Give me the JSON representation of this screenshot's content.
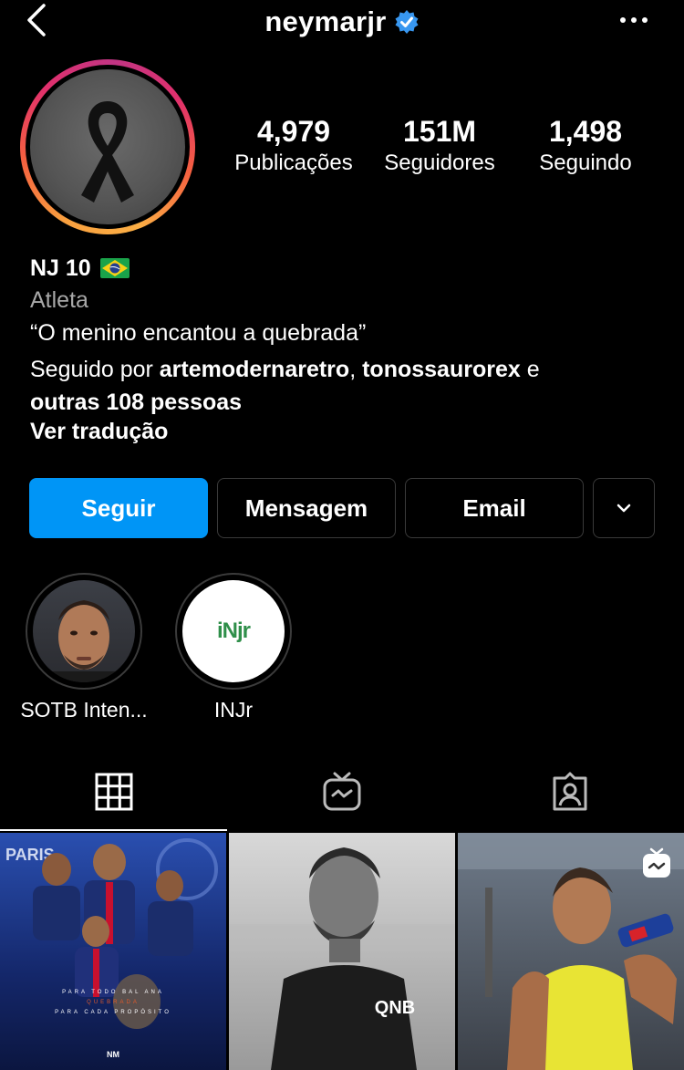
{
  "header": {
    "username": "neymarjr",
    "icons": {
      "back": "chevron-left-icon",
      "verified": "verified-badge-icon",
      "more": "more-horizontal-icon"
    },
    "verified_color": "#3897f0"
  },
  "avatar": {
    "icon": "black-ribbon-icon"
  },
  "stats": [
    {
      "value": "4,979",
      "label": "Publicações"
    },
    {
      "value": "151M",
      "label": "Seguidores"
    },
    {
      "value": "1,498",
      "label": "Seguindo"
    }
  ],
  "profile": {
    "name": "NJ 10",
    "flag_icon": "brazil-flag-icon",
    "category": "Atleta",
    "bio": "“O menino encantou a quebrada”",
    "followed_prefix": "Seguido por ",
    "followed_user_1": "artemodernaretro",
    "followed_sep": ", ",
    "followed_user_2": "tonossaurorex",
    "followed_and": " e",
    "followed_others": "outras 108 pessoas",
    "translate": "Ver tradução"
  },
  "buttons": {
    "follow": "Seguir",
    "message": "Mensagem",
    "email": "Email",
    "dropdown_icon": "chevron-down-icon"
  },
  "accent_color": "#0095f6",
  "highlights": [
    {
      "label": "SOTB Inten..."
    },
    {
      "label": "INJr",
      "logo_text": "iNjr"
    }
  ],
  "tabs": [
    {
      "icon": "grid-icon",
      "active": true
    },
    {
      "icon": "igtv-icon",
      "active": false
    },
    {
      "icon": "tagged-icon",
      "active": false
    }
  ],
  "posts": [
    {
      "image": "psg-poster",
      "text_lines": [
        "PARIS",
        "PARA TODO BAL ANA",
        "QUEBRADA",
        "PARA CADA PROPÓSITO",
        "NM"
      ]
    },
    {
      "image": "bw-portrait",
      "sponsor": "QNB"
    },
    {
      "image": "drinking-photo",
      "badge_icon": "igtv-badge-icon"
    }
  ]
}
